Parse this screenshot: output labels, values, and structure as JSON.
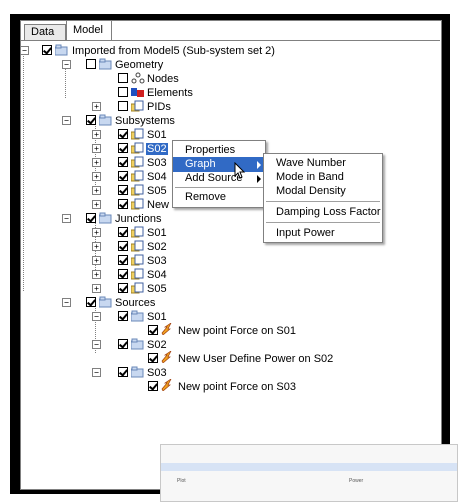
{
  "tabs": {
    "data": "Data",
    "model": "Model"
  },
  "tree": {
    "root": "Imported from Model5 (Sub-system set 2)",
    "geometry": "Geometry",
    "nodes": "Nodes",
    "elements": "Elements",
    "pids": "PIDs",
    "subsystems": "Subsystems",
    "subsystem_items": [
      "S01",
      "S02",
      "S03",
      "S04",
      "S05",
      "New"
    ],
    "junctions": "Junctions",
    "junction_items": [
      "S01",
      "S02",
      "S03",
      "S04",
      "S05"
    ],
    "sources": "Sources",
    "source_groups": [
      {
        "label": "S01",
        "child": "New point Force on S01"
      },
      {
        "label": "S02",
        "child": "New User Define Power on S02"
      },
      {
        "label": "S03",
        "child": "New point Force on S03"
      }
    ]
  },
  "context_menu": {
    "items": [
      "Properties",
      "Graph",
      "Add Source",
      "Remove"
    ],
    "highlighted": "Graph"
  },
  "submenu": {
    "items": [
      "Wave Number",
      "Mode in Band",
      "Modal Density",
      "Damping Loss Factor",
      "Input Power"
    ]
  },
  "thumbnail": {
    "col1": "Plot",
    "col2": "Power"
  },
  "colors": {
    "selection": "#316ac5",
    "frame": "#000000"
  }
}
